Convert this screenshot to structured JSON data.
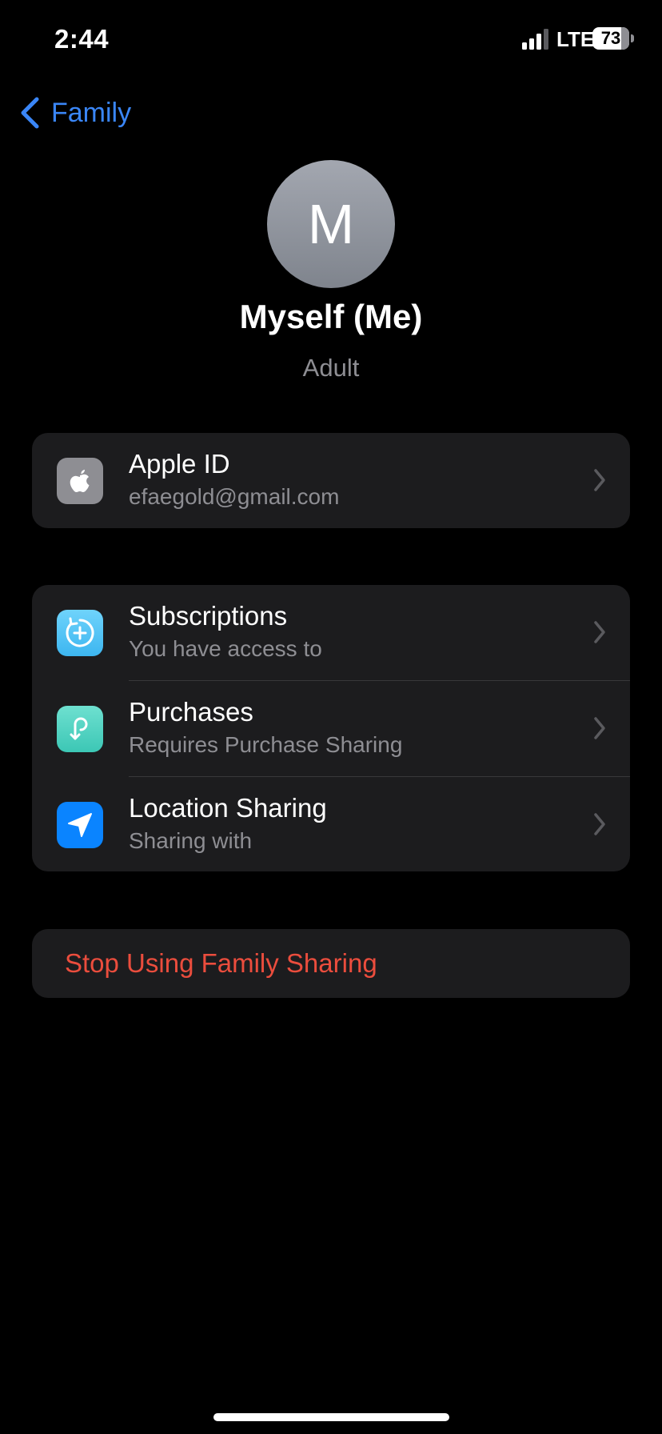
{
  "status_bar": {
    "time": "2:44",
    "network": "LTE",
    "battery": "73"
  },
  "nav": {
    "back_label": "Family"
  },
  "profile": {
    "initial": "M",
    "name": "Myself (Me)",
    "role": "Adult"
  },
  "account_group": [
    {
      "title": "Apple ID",
      "subtitle": "efaegold@gmail.com",
      "icon": "apple-logo-icon",
      "icon_color": "#8e8e93"
    }
  ],
  "features_group": [
    {
      "title": "Subscriptions",
      "subtitle": "You have access to",
      "icon": "subscriptions-icon",
      "icon_color": "#5ac8fa"
    },
    {
      "title": "Purchases",
      "subtitle": "Requires Purchase Sharing",
      "icon": "purchases-icon",
      "icon_color": "#4fd1c5"
    },
    {
      "title": "Location Sharing",
      "subtitle": "Sharing with",
      "icon": "location-arrow-icon",
      "icon_color": "#0a84ff"
    }
  ],
  "actions": {
    "stop_sharing": "Stop Using Family Sharing"
  },
  "colors": {
    "accent": "#3a86f7",
    "destructive": "#eb4d3d",
    "background": "#000000",
    "cell": "#1c1c1e"
  }
}
